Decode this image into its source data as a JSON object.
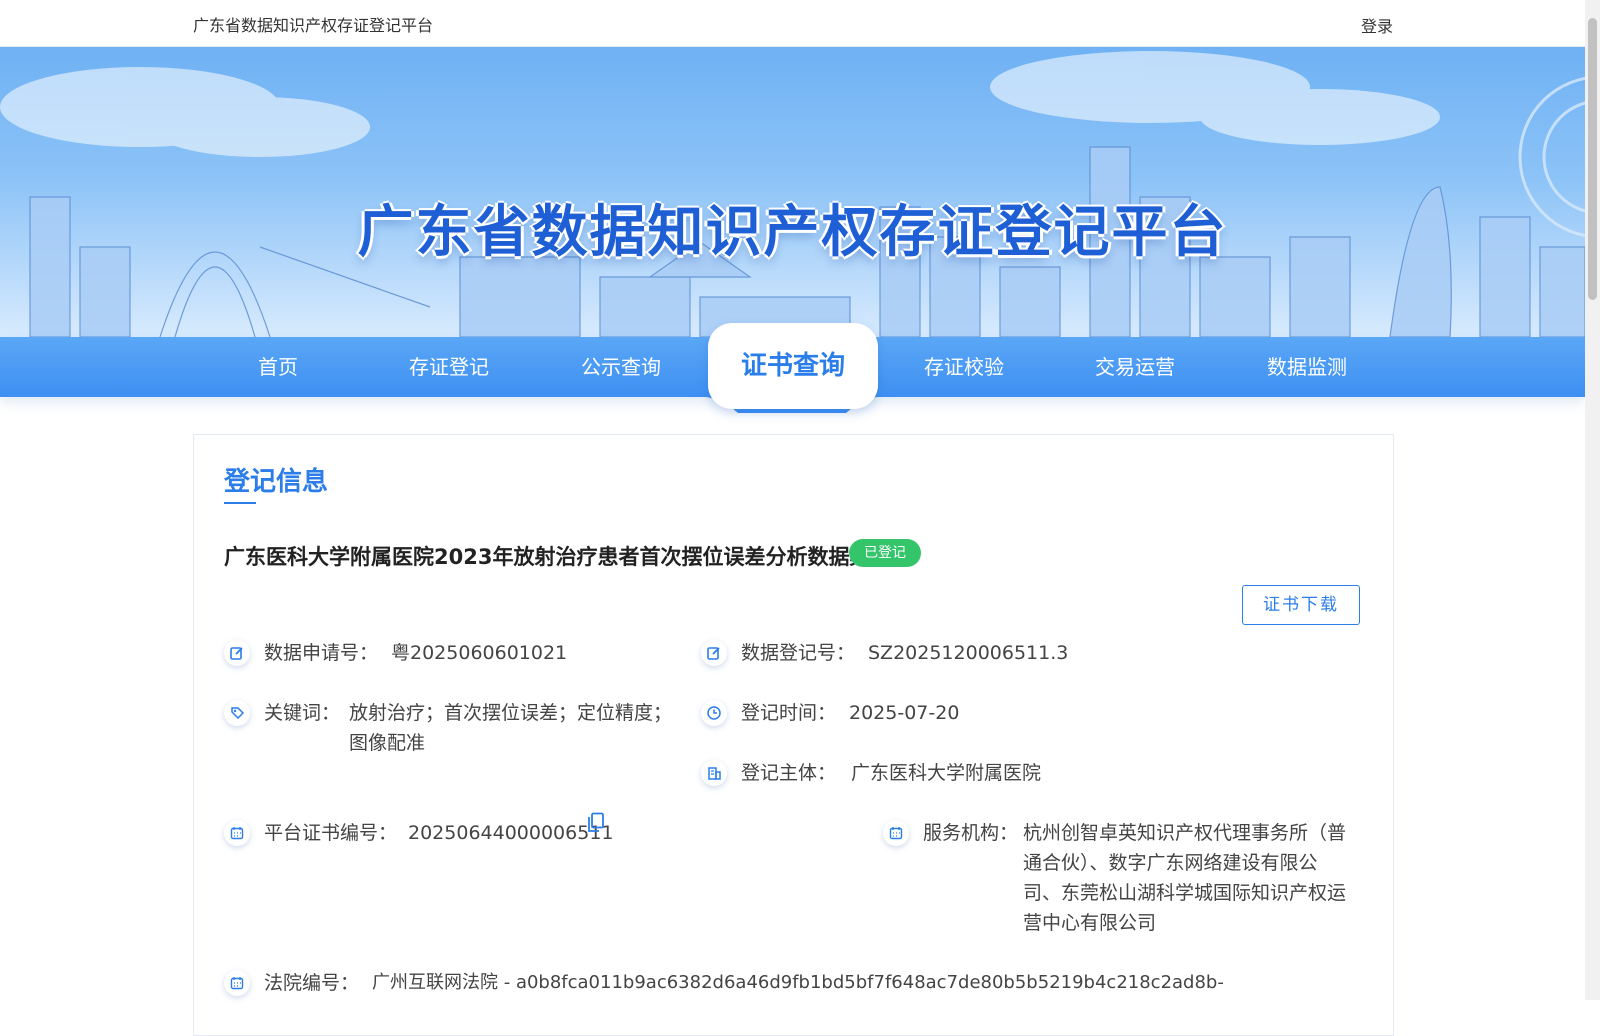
{
  "header": {
    "site_name": "广东省数据知识产权存证登记平台",
    "login_label": "登录"
  },
  "banner": {
    "title": "广东省数据知识产权存证登记平台"
  },
  "nav": {
    "items": [
      {
        "label": "首页",
        "active": false
      },
      {
        "label": "存证登记",
        "active": false
      },
      {
        "label": "公示查询",
        "active": false
      },
      {
        "label": "证书查询",
        "active": true
      },
      {
        "label": "存证校验",
        "active": false
      },
      {
        "label": "交易运营",
        "active": false
      },
      {
        "label": "数据监测",
        "active": false
      }
    ]
  },
  "registration": {
    "section_title": "登记信息",
    "dataset_title": "广东医科大学附属医院2023年放射治疗患者首次摆位误差分析数据集",
    "status": "已登记",
    "download_label": "证书下载",
    "fields": {
      "application_no": {
        "label": "数据申请号：",
        "value": "粤2025060601021"
      },
      "registration_no": {
        "label": "数据登记号：",
        "value": "SZ2025120006511.3"
      },
      "keywords": {
        "label": "关键词：",
        "value": "放射治疗；首次摆位误差；定位精度；图像配准"
      },
      "registration_time": {
        "label": "登记时间：",
        "value": "2025-07-20"
      },
      "registrant": {
        "label": "登记主体：",
        "value": "广东医科大学附属医院"
      },
      "platform_cert_no": {
        "label": "平台证书编号：",
        "value": "20250644000006511"
      },
      "service_org": {
        "label": "服务机构：",
        "value": "杭州创智卓英知识产权代理事务所（普通合伙）、数字广东网络建设有限公司、东莞松山湖科学城国际知识产权运营中心有限公司"
      },
      "court_no": {
        "label": "法院编号：",
        "value": "广州互联网法院 - a0b8fca011b9ac6382d6a46d9fb1bd5bf7f648ac7de80b5b5219b4c218c2ad8b-"
      }
    }
  },
  "colors": {
    "primary": "#2b7de9",
    "nav_blue": "#3d8ff2",
    "status_green": "#34c46a"
  }
}
